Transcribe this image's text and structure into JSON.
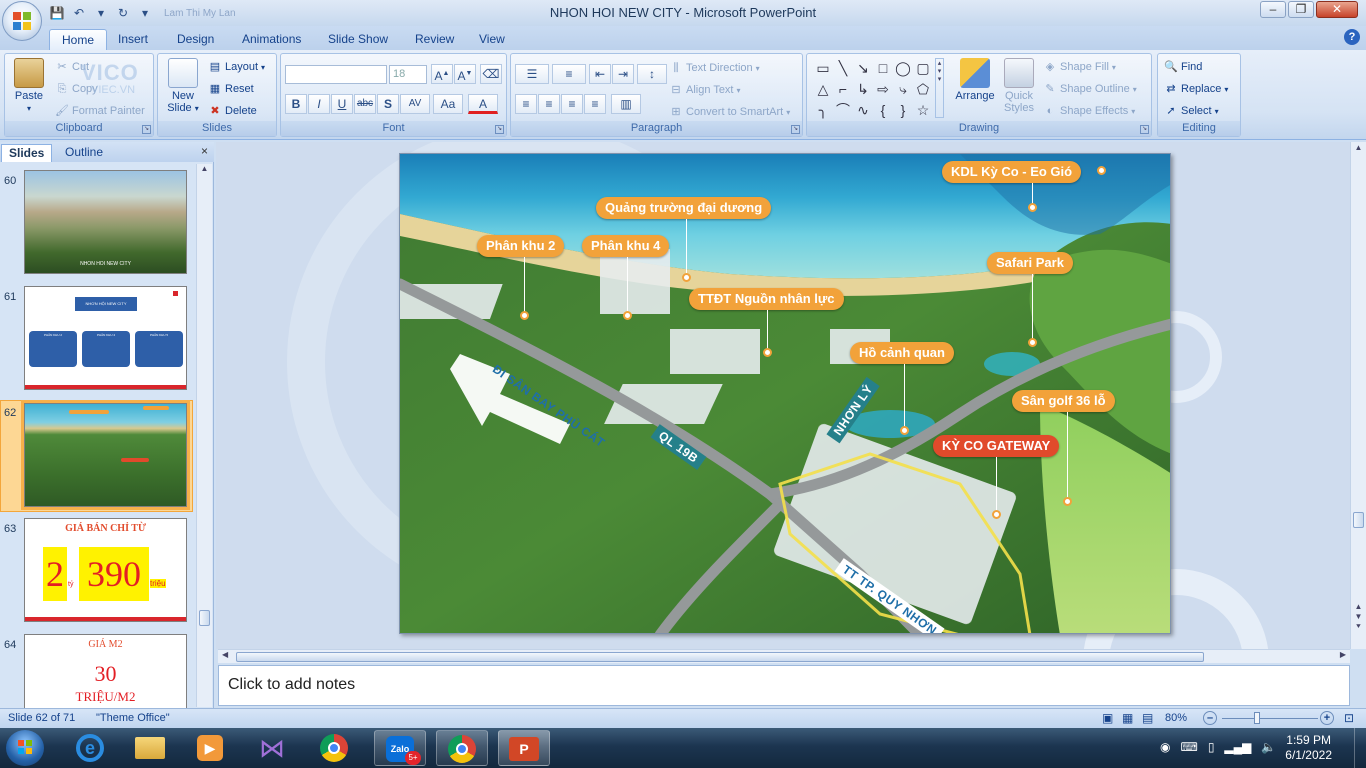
{
  "window": {
    "title": "NHON HOI NEW CITY - Microsoft PowerPoint",
    "qat_doc": "Lam Thi My Lan",
    "minimize": "–",
    "maximize": "❐",
    "close": "✕"
  },
  "ribbon_tabs": [
    "Home",
    "Insert",
    "Design",
    "Animations",
    "Slide Show",
    "Review",
    "View"
  ],
  "clipboard": {
    "paste": "Paste",
    "cut": "Cut",
    "copy": "Copy",
    "format_painter": "Format Painter",
    "label": "Clipboard",
    "watermark": "VICO",
    "watermark2": "VIEC.VN"
  },
  "slides_group": {
    "new_slide": "New Slide",
    "layout": "Layout",
    "reset": "Reset",
    "delete": "Delete",
    "label": "Slides"
  },
  "font_group": {
    "font_name": "",
    "font_size": "18",
    "label": "Font",
    "bold": "B",
    "italic": "I",
    "underline": "U",
    "strike": "abc",
    "shadow": "S",
    "spacing": "AV",
    "case": "Aa",
    "color": "A"
  },
  "paragraph_group": {
    "text_direction": "Text Direction",
    "align_text": "Align Text",
    "convert": "Convert to SmartArt",
    "label": "Paragraph"
  },
  "drawing_group": {
    "arrange": "Arrange",
    "quick_styles": "Quick Styles",
    "shape_fill": "Shape Fill",
    "shape_outline": "Shape Outline",
    "shape_effects": "Shape Effects",
    "label": "Drawing"
  },
  "editing_group": {
    "find": "Find",
    "replace": "Replace",
    "select": "Select",
    "label": "Editing"
  },
  "pane_tabs": {
    "slides": "Slides",
    "outline": "Outline",
    "close": "×"
  },
  "thumbnails": [
    {
      "num": "60",
      "caption": "NHON HOI NEW CITY"
    },
    {
      "num": "61",
      "title": "NHƠN HỘI NEW CITY",
      "boxes": [
        "PHÂN KHU 2",
        "PHÂN KHU 4",
        "PHÂN KHU 5"
      ]
    },
    {
      "num": "62"
    },
    {
      "num": "63",
      "title": "GIÁ BÁN CHỈ TỪ",
      "price_a": "2",
      "unit_a": "tỷ",
      "price_b": "390",
      "unit_b": "triệu"
    },
    {
      "num": "64",
      "title": "GIÁ M2",
      "value": "30",
      "unit": "TRIỆU/M2"
    }
  ],
  "slide_labels": {
    "kdl": "KDL Kỳ Co - Eo Gió",
    "quang_truong": "Quảng trường đại dương",
    "phan_khu_2": "Phân khu 2",
    "phan_khu_4": "Phân khu 4",
    "safari": "Safari Park",
    "ttdt": "TTĐT Nguồn nhân lực",
    "ho_canh_quan": "Hồ cảnh quan",
    "san_golf": "Sân golf 36 lỗ",
    "gateway": "KỲ CO GATEWAY",
    "road_airport": "ĐI SÂN BAY PHÙ CÁT",
    "road_ql": "QL 19B",
    "road_nhonly": "NHƠN LÝ",
    "road_quynhon": "TT TP. QUY NHƠN"
  },
  "notes": {
    "placeholder": "Click to add notes"
  },
  "status": {
    "slide": "Slide 62 of 71",
    "theme": "\"Theme Office\"",
    "zoom": "80%"
  },
  "taskbar": {
    "time": "1:59 PM",
    "date": "6/1/2022",
    "zalo_badge": "5+",
    "zalo": "Zalo"
  },
  "colors": {
    "label_orange": "#f2a23a",
    "label_red": "#e14a2b",
    "ribbon": "#d5e3f4"
  }
}
